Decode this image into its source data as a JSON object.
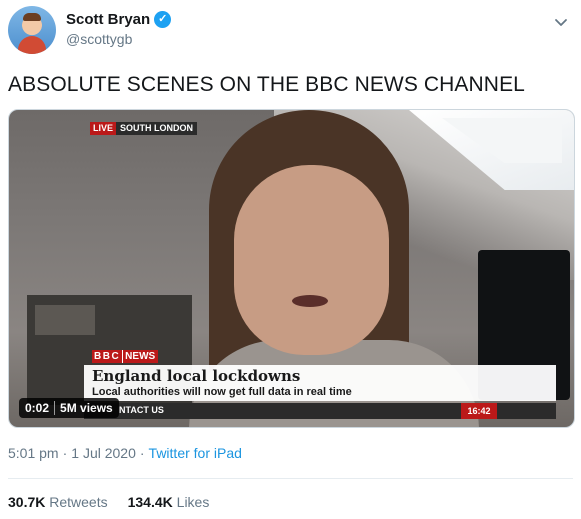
{
  "author": {
    "display_name": "Scott Bryan",
    "handle": "@scottygb",
    "verified_icon": "verified-check-icon"
  },
  "tweet": {
    "text": "ABSOLUTE SCENES ON THE BBC NEWS CHANNEL"
  },
  "video": {
    "live_label": "LIVE",
    "location_label": "SOUTH LONDON",
    "channel_logo_blocks": "BBC",
    "channel_logo_news": "NEWS",
    "headline": "England local lockdowns",
    "subheadline": "Local authorities will now get full data in real time",
    "ticker_text": "NTACT US",
    "clock": "16:42",
    "elapsed": "0:02",
    "views": "5M views"
  },
  "meta": {
    "time": "5:01 pm",
    "separator1": "·",
    "date": "1 Jul 2020",
    "separator2": "·",
    "source": "Twitter for iPad"
  },
  "stats": {
    "retweets_count": "30.7K",
    "retweets_label": "Retweets",
    "likes_count": "134.4K",
    "likes_label": "Likes"
  },
  "colors": {
    "link": "#1b95e0",
    "verified": "#1da1f2",
    "bbc_red": "#bb1919"
  }
}
